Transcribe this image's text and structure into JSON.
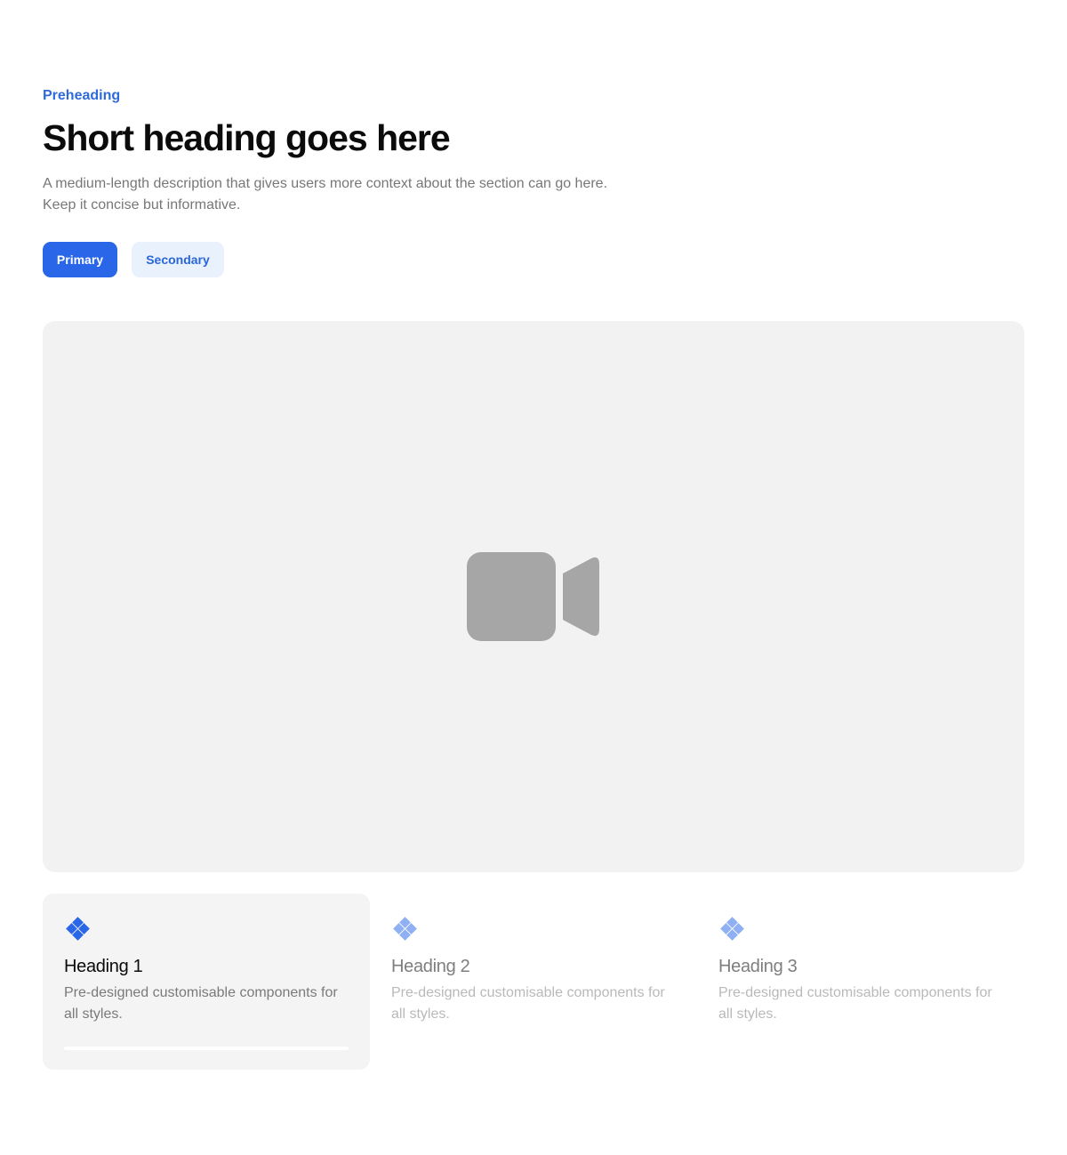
{
  "section": {
    "preheading": "Preheading",
    "title": "Short heading goes here",
    "description": "A medium-length description that gives users more context about the section can go here. Keep it concise but informative."
  },
  "actions": {
    "primary_label": "Primary",
    "secondary_label": "Secondary"
  },
  "media": {
    "icon": "video-camera-icon"
  },
  "features": [
    {
      "icon": "diamond-grid-icon",
      "heading": "Heading 1",
      "text": "Pre-designed customisable components for all styles.",
      "active": true,
      "progress": 1.0
    },
    {
      "icon": "diamond-grid-icon",
      "heading": "Heading 2",
      "text": "Pre-designed customisable components for all styles.",
      "active": false
    },
    {
      "icon": "diamond-grid-icon",
      "heading": "Heading 3",
      "text": "Pre-designed customisable components for all styles.",
      "active": false
    }
  ],
  "colors": {
    "accent": "#2a66e8",
    "accent_light": "#8fb0f2",
    "secondary_bg": "#e9f1fd",
    "media_bg": "#f2f2f2",
    "icon_gray": "#a6a6a6"
  }
}
